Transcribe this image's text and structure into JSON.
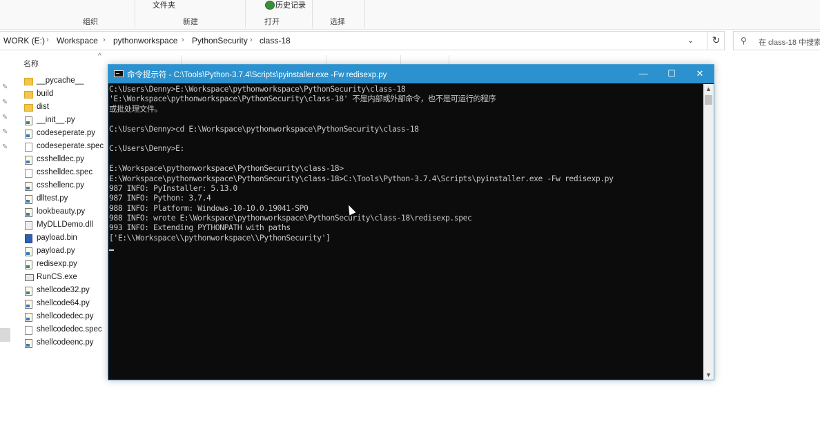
{
  "ribbon": {
    "wenjianjia": "文件夹",
    "history": "历史记录",
    "history_icon": "history-icon",
    "groups": [
      "组织",
      "新建",
      "打开",
      "选择"
    ]
  },
  "address": {
    "crumbs": [
      "WORK (E:)",
      "Workspace",
      "pythonworkspace",
      "PythonSecurity",
      "class-18"
    ],
    "separator": "›",
    "dropdown": "⌄",
    "refresh": "↻",
    "search_placeholder": "在 class-18 中搜索"
  },
  "columns": {
    "name": "名称"
  },
  "files": [
    {
      "name": "__pycache__",
      "type": "folder"
    },
    {
      "name": "build",
      "type": "folder"
    },
    {
      "name": "dist",
      "type": "folder"
    },
    {
      "name": "__init__.py",
      "type": "py"
    },
    {
      "name": "codeseperate.py",
      "type": "py"
    },
    {
      "name": "codeseperate.spec",
      "type": "doc"
    },
    {
      "name": "csshelldec.py",
      "type": "py"
    },
    {
      "name": "csshelldec.spec",
      "type": "doc"
    },
    {
      "name": "csshellenc.py",
      "type": "py"
    },
    {
      "name": "dlltest.py",
      "type": "py"
    },
    {
      "name": "lookbeauty.py",
      "type": "py"
    },
    {
      "name": "MyDLLDemo.dll",
      "type": "dll"
    },
    {
      "name": "payload.bin",
      "type": "bin"
    },
    {
      "name": "payload.py",
      "type": "py"
    },
    {
      "name": "redisexp.py",
      "type": "py"
    },
    {
      "name": "RunCS.exe",
      "type": "exe"
    },
    {
      "name": "shellcode32.py",
      "type": "py"
    },
    {
      "name": "shellcode64.py",
      "type": "py"
    },
    {
      "name": "shellcodedec.py",
      "type": "py"
    },
    {
      "name": "shellcodedec.spec",
      "type": "doc"
    },
    {
      "name": "shellcodeenc.py",
      "type": "py"
    }
  ],
  "cmd": {
    "title": "命令提示符 - C:\\Tools\\Python-3.7.4\\Scripts\\pyinstaller.exe  -Fw redisexp.py",
    "minimize": "—",
    "maximize": "☐",
    "close": "✕",
    "lines": [
      "C:\\Users\\Denny>E:\\Workspace\\pythonworkspace\\PythonSecurity\\class-18",
      "'E:\\Workspace\\pythonworkspace\\PythonSecurity\\class-18' 不是内部或外部命令，也不是可运行的程序",
      "或批处理文件。",
      "",
      "C:\\Users\\Denny>cd E:\\Workspace\\pythonworkspace\\PythonSecurity\\class-18",
      "",
      "C:\\Users\\Denny>E:",
      "",
      "E:\\Workspace\\pythonworkspace\\PythonSecurity\\class-18>",
      "E:\\Workspace\\pythonworkspace\\PythonSecurity\\class-18>C:\\Tools\\Python-3.7.4\\Scripts\\pyinstaller.exe -Fw redisexp.py",
      "987 INFO: PyInstaller: 5.13.0",
      "987 INFO: Python: 3.7.4",
      "988 INFO: Platform: Windows-10-10.0.19041-SP0",
      "988 INFO: wrote E:\\Workspace\\pythonworkspace\\PythonSecurity\\class-18\\redisexp.spec",
      "993 INFO: Extending PYTHONPATH with paths",
      "['E:\\\\Workspace\\\\pythonworkspace\\\\PythonSecurity']"
    ],
    "scroll_up": "▲",
    "scroll_down": "▼"
  },
  "colors": {
    "titlebar": "#2b92cf",
    "console_bg": "#0c0c0c",
    "console_fg": "#c8c8c8"
  }
}
